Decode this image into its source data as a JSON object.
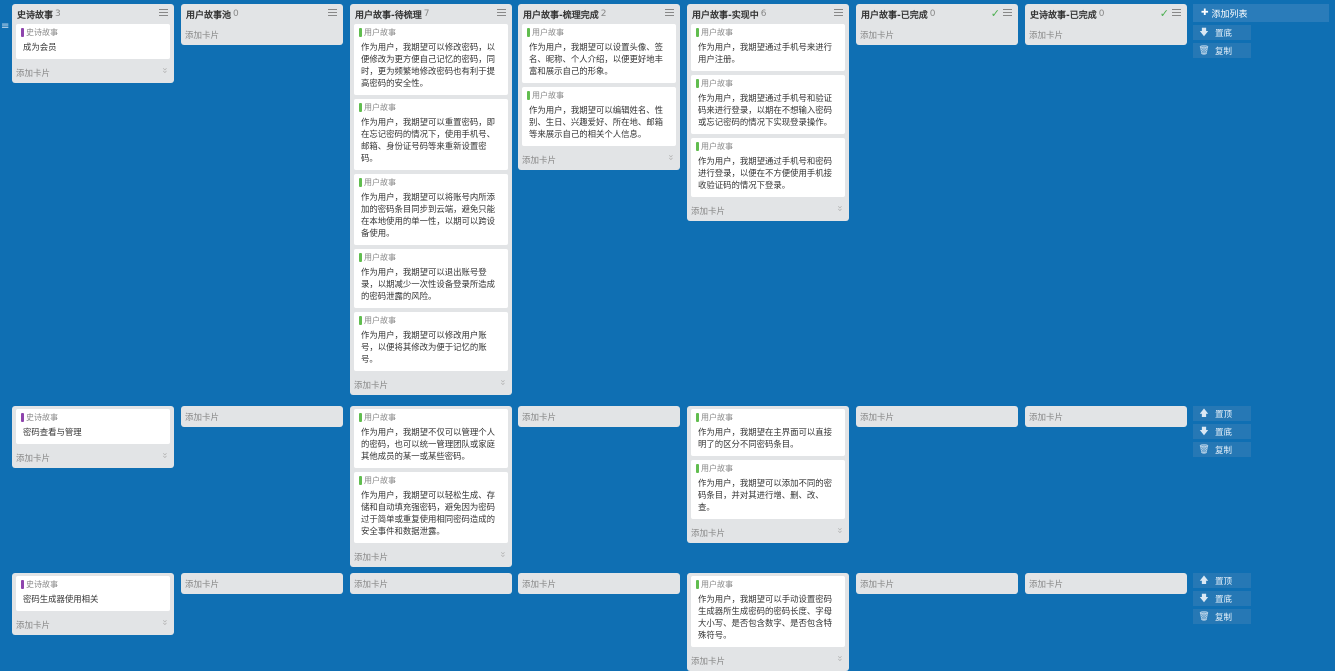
{
  "board": {
    "add_list_label": "添加列表",
    "columns": [
      {
        "title": "史诗故事",
        "count": "3"
      },
      {
        "title": "用户故事池",
        "count": "0"
      },
      {
        "title": "用户故事-待梳理",
        "count": "7"
      },
      {
        "title": "用户故事-梳理完成",
        "count": "2"
      },
      {
        "title": "用户故事-实现中",
        "count": "6"
      },
      {
        "title": "用户故事-已完成",
        "count": "0"
      },
      {
        "title": "史诗故事-已完成",
        "count": "0"
      }
    ],
    "add_card_label": "添加卡片",
    "lane_controls": {
      "top": "置顶",
      "bottom": "置底",
      "copy": "复制"
    },
    "tags": {
      "epic": "史诗故事",
      "story": "用户故事"
    },
    "colors": {
      "epic_tag": "#8e44ad",
      "story_tag": "#61bd4f",
      "background": "#0f6fb3"
    },
    "lanes": [
      {
        "epic": "成为会员",
        "c2": [
          "作为用户，我期望可以修改密码，以便修改为更方便自己记忆的密码，同时，更为频繁地修改密码也有利于提高密码的安全性。",
          "作为用户，我期望可以重置密码，即在忘记密码的情况下，使用手机号、邮箱、身份证号码等来重新设置密码。",
          "作为用户，我期望可以将账号内所添加的密码条目同步到云端，避免只能在本地使用的单一性，以期可以跨设备使用。",
          "作为用户，我期望可以退出账号登录，以期减少一次性设备登录所造成的密码泄露的风险。",
          "作为用户，我期望可以修改用户账号，以便将其修改为便于记忆的账号。"
        ],
        "c3": [
          "作为用户，我期望可以设置头像、签名、昵称、个人介绍，以便更好地丰富和展示自己的形象。",
          "作为用户，我期望可以编辑姓名、性别、生日、兴趣爱好、所在地、邮箱等来展示自己的相关个人信息。"
        ],
        "c4": [
          "作为用户，我期望通过手机号来进行用户注册。",
          "作为用户，我期望通过手机号和验证码来进行登录，以期在不想输入密码或忘记密码的情况下实现登录操作。",
          "作为用户，我期望通过手机号和密码进行登录，以便在不方便使用手机接收验证码的情况下登录。"
        ]
      },
      {
        "epic": "密码查看与管理",
        "c2": [
          "作为用户，我期望不仅可以管理个人的密码，也可以统一管理团队或家庭其他成员的某一或某些密码。",
          "作为用户，我期望可以轻松生成、存储和自动填充强密码，避免因为密码过于简单或重复使用相同密码造成的安全事件和数据泄露。"
        ],
        "c4": [
          "作为用户，我期望在主界面可以直接明了的区分不同密码条目。",
          "作为用户，我期望可以添加不同的密码条目，并对其进行增、删、改、查。"
        ]
      },
      {
        "epic": "密码生成器使用相关",
        "c4": [
          "作为用户，我期望可以手动设置密码生成器所生成密码的密码长度、字母大小写、是否包含数字、是否包含特殊符号。"
        ]
      }
    ]
  }
}
